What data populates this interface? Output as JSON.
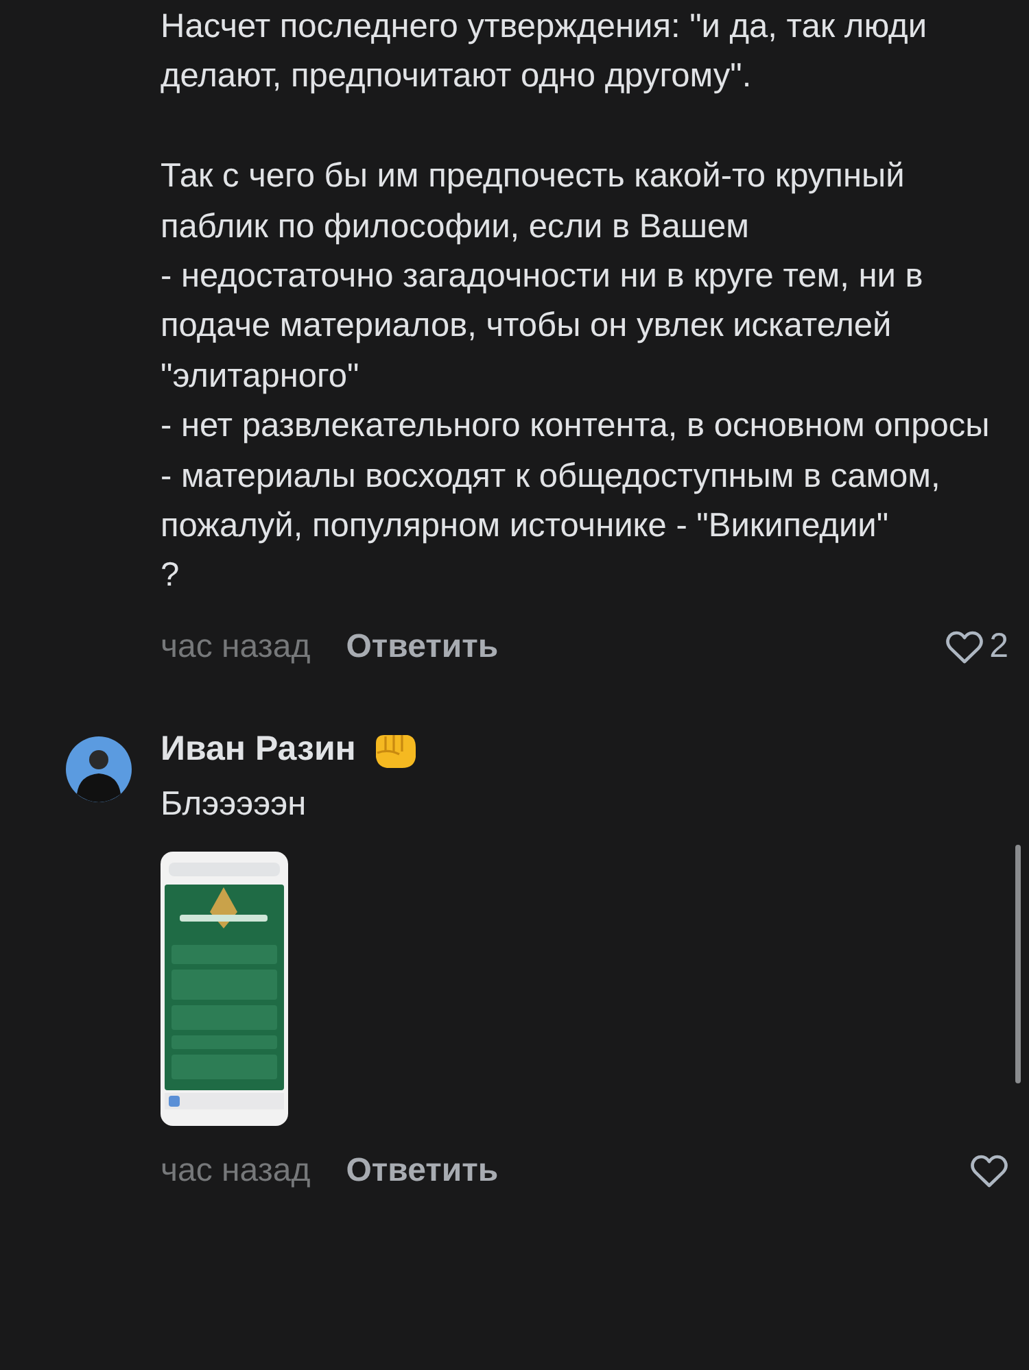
{
  "comments": [
    {
      "text": "Насчет последнего утверждения: \"и да, так люди делают, предпочитают одно другому\".\n\nТак с чего бы им предпочесть какой-то крупный паблик по философии, если в Вашем\n- недостаточно загадочности ни в круге тем, ни в подаче материалов, чтобы он увлек искателей \"элитарного\"\n- нет развлекательного контента, в основном опросы\n- материалы восходят к общедоступным в самом, пожалуй, популярном источнике - \"Википедии\"\n?",
      "time": "час назад",
      "reply": "Ответить",
      "likes": "2"
    },
    {
      "author": "Иван Разин",
      "text": "Блэээээн",
      "time": "час назад",
      "reply": "Ответить"
    }
  ]
}
